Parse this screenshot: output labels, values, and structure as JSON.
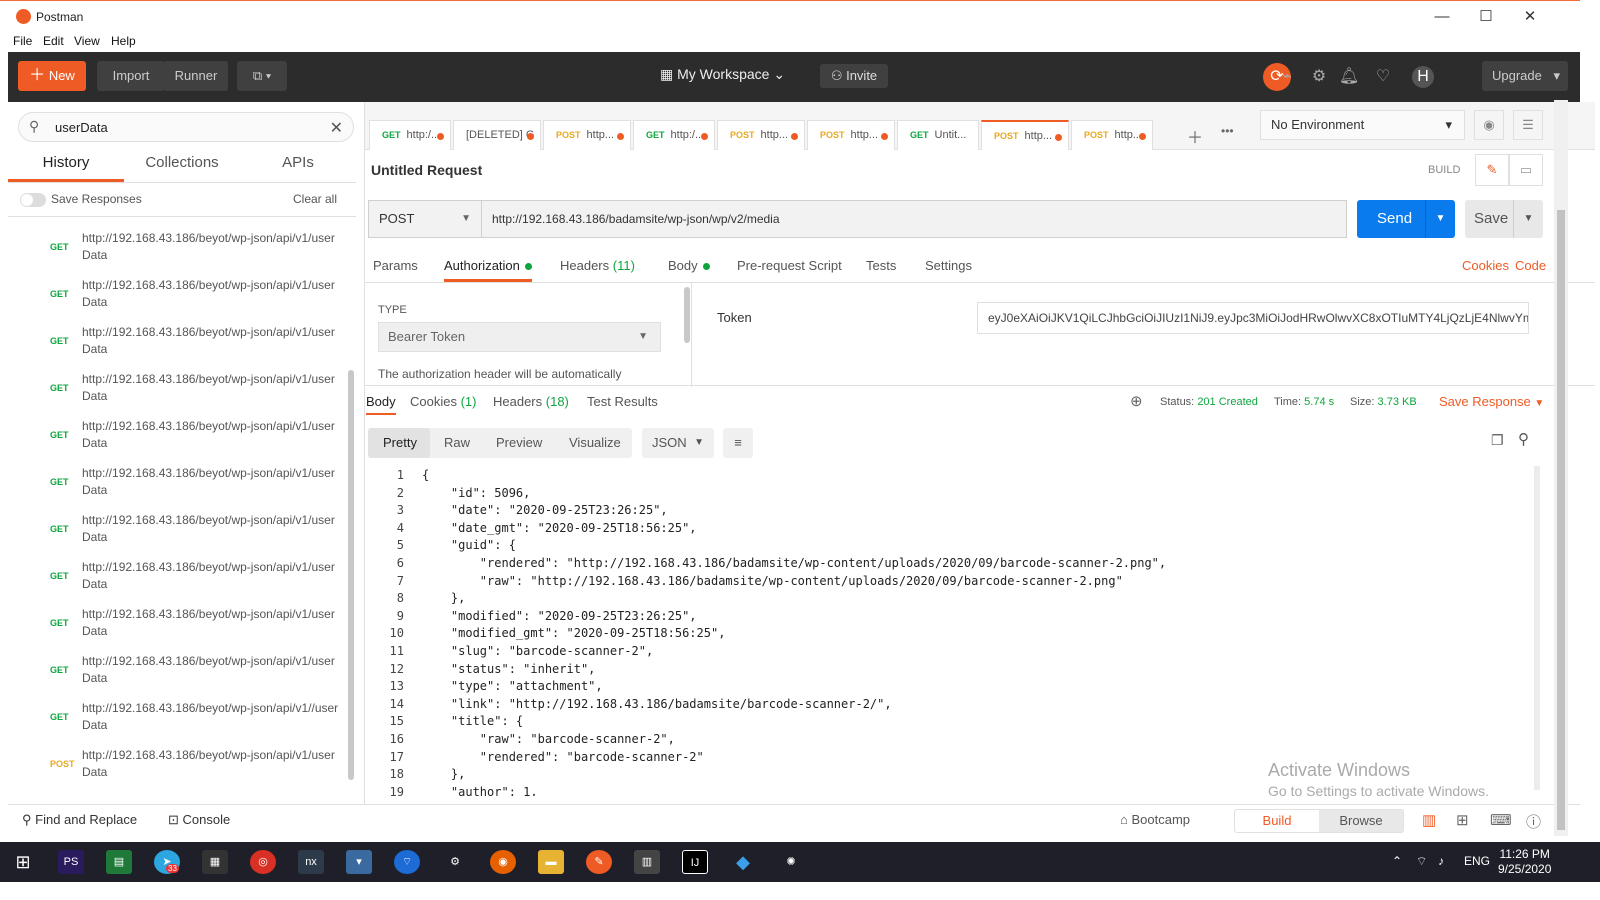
{
  "window": {
    "title": "Postman",
    "min": "—",
    "max": "☐",
    "close": "✕"
  },
  "menu": [
    "File",
    "Edit",
    "View",
    "Help"
  ],
  "header": {
    "new": "New",
    "import": "Import",
    "runner": "Runner",
    "workspace": "My Workspace",
    "invite": "Invite",
    "upgrade": "Upgrade"
  },
  "sidebar": {
    "search_value": "userData",
    "tabs": [
      "History",
      "Collections",
      "APIs"
    ],
    "save_responses": "Save Responses",
    "clear_all": "Clear all",
    "items": [
      {
        "method": "GET",
        "url": "http://192.168.43.186/beyot/wp-json/api/v1/userData"
      },
      {
        "method": "GET",
        "url": "http://192.168.43.186/beyot/wp-json/api/v1/userData"
      },
      {
        "method": "GET",
        "url": "http://192.168.43.186/beyot/wp-json/api/v1/userData"
      },
      {
        "method": "GET",
        "url": "http://192.168.43.186/beyot/wp-json/api/v1/userData"
      },
      {
        "method": "GET",
        "url": "http://192.168.43.186/beyot/wp-json/api/v1/userData"
      },
      {
        "method": "GET",
        "url": "http://192.168.43.186/beyot/wp-json/api/v1/userData"
      },
      {
        "method": "GET",
        "url": "http://192.168.43.186/beyot/wp-json/api/v1/userData"
      },
      {
        "method": "GET",
        "url": "http://192.168.43.186/beyot/wp-json/api/v1/userData"
      },
      {
        "method": "GET",
        "url": "http://192.168.43.186/beyot/wp-json/api/v1/userData"
      },
      {
        "method": "GET",
        "url": "http://192.168.43.186/beyot/wp-json/api/v1/userData"
      },
      {
        "method": "GET",
        "url": "http://192.168.43.186/beyot/wp-json/api/v1//userData"
      },
      {
        "method": "POST",
        "url": "http://192.168.43.186/beyot/wp-json/api/v1/userData"
      }
    ]
  },
  "request_tabs": [
    {
      "method": "GET",
      "label": "http:/..."
    },
    {
      "method": "",
      "label": "[DELETED] G"
    },
    {
      "method": "POST",
      "label": "http..."
    },
    {
      "method": "GET",
      "label": "http:/..."
    },
    {
      "method": "POST",
      "label": "http..."
    },
    {
      "method": "POST",
      "label": "http..."
    },
    {
      "method": "GET",
      "label": "Untit..."
    },
    {
      "method": "POST",
      "label": "http..."
    },
    {
      "method": "POST",
      "label": "http..."
    }
  ],
  "environment": "No Environment",
  "request": {
    "title": "Untitled Request",
    "build": "BUILD",
    "method": "POST",
    "url": "http://192.168.43.186/badamsite/wp-json/wp/v2/media",
    "send": "Send",
    "save": "Save",
    "tabs": {
      "params": "Params",
      "authorization": "Authorization",
      "headers": "Headers",
      "headers_count": "(11)",
      "body": "Body",
      "prerequest": "Pre-request Script",
      "tests": "Tests",
      "settings": "Settings"
    },
    "cookies": "Cookies",
    "code": "Code",
    "auth": {
      "type_label": "TYPE",
      "type": "Bearer Token",
      "note": "The authorization header will be automatically",
      "token_label": "Token",
      "token": "eyJ0eXAiOiJKV1QiLCJhbGciOiJIUzI1NiJ9.eyJpc3MiOiJodHRwOlwvXC8xOTIuMTY4LjQzLjE4NlwvYmF ..."
    }
  },
  "response": {
    "tabs": {
      "body": "Body",
      "cookies": "Cookies",
      "cookies_count": "(1)",
      "headers": "Headers",
      "headers_count": "(18)",
      "test_results": "Test Results"
    },
    "status_label": "Status:",
    "status": "201 Created",
    "time_label": "Time:",
    "time": "5.74 s",
    "size_label": "Size:",
    "size": "3.73 KB",
    "save_response": "Save Response",
    "views": [
      "Pretty",
      "Raw",
      "Preview",
      "Visualize"
    ],
    "format": "JSON",
    "lines": [
      "{",
      "    \"id\": 5096,",
      "    \"date\": \"2020-09-25T23:26:25\",",
      "    \"date_gmt\": \"2020-09-25T18:56:25\",",
      "    \"guid\": {",
      "        \"rendered\": \"http://192.168.43.186/badamsite/wp-content/uploads/2020/09/barcode-scanner-2.png\",",
      "        \"raw\": \"http://192.168.43.186/badamsite/wp-content/uploads/2020/09/barcode-scanner-2.png\"",
      "    },",
      "    \"modified\": \"2020-09-25T23:26:25\",",
      "    \"modified_gmt\": \"2020-09-25T18:56:25\",",
      "    \"slug\": \"barcode-scanner-2\",",
      "    \"status\": \"inherit\",",
      "    \"type\": \"attachment\",",
      "    \"link\": \"http://192.168.43.186/badamsite/barcode-scanner-2/\",",
      "    \"title\": {",
      "        \"raw\": \"barcode-scanner-2\",",
      "        \"rendered\": \"barcode-scanner-2\"",
      "    },",
      "    \"author\": 1,"
    ]
  },
  "watermark": {
    "line1": "Activate Windows",
    "line2": "Go to Settings to activate Windows."
  },
  "statusbar": {
    "find_replace": "Find and Replace",
    "console": "Console",
    "bootcamp": "Bootcamp",
    "build": "Build",
    "browse": "Browse"
  },
  "taskbar": {
    "lang": "ENG",
    "time": "11:26 PM",
    "date": "9/25/2020",
    "badge": "33"
  },
  "colors": {
    "accent": "#ef5b25",
    "send": "#097bed",
    "ok": "#0ea53f",
    "post": "#e8a91f"
  }
}
